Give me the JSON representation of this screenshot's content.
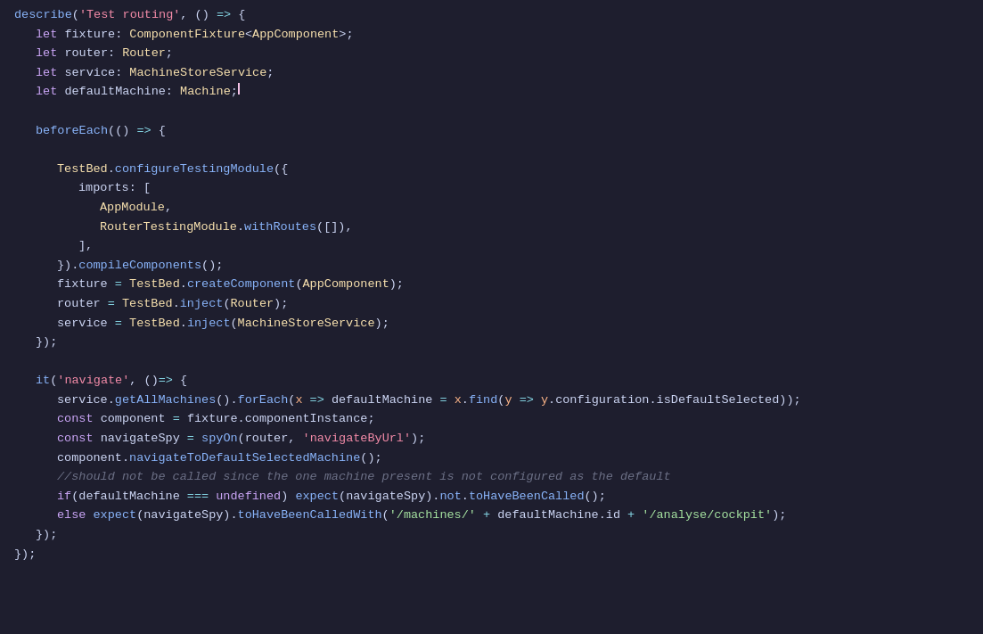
{
  "title": "Test routing",
  "language": "typescript",
  "lines": [
    "describe_line",
    "let_fixture",
    "let_router",
    "let_service",
    "let_default",
    "empty1",
    "beforeEach",
    "empty2",
    "testbed_configure",
    "imports_label",
    "appmodule",
    "router_testing",
    "bracket_close",
    "compile",
    "fixture_assign",
    "router_assign",
    "service_assign",
    "brace_close",
    "empty3",
    "it_navigate",
    "service_getall",
    "const_component",
    "const_spy",
    "component_navigate",
    "comment_line",
    "if_default",
    "else_line",
    "close_it"
  ]
}
